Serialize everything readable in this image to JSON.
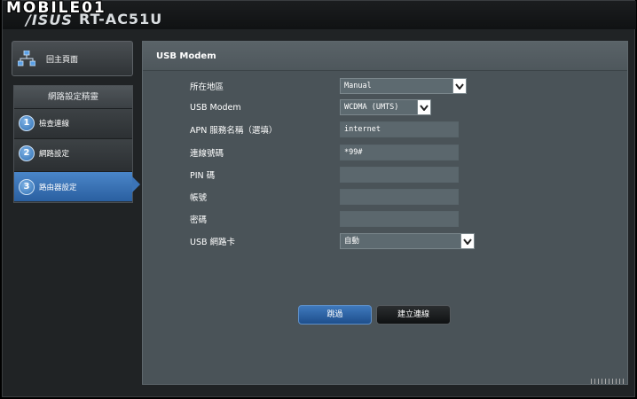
{
  "header": {
    "watermark": "MOBILE01",
    "brand": "/ISUS",
    "model": "RT-AC51U"
  },
  "sidebar": {
    "home_label": "回主頁面",
    "wizard_title": "網路設定精靈",
    "steps": [
      {
        "number": "1",
        "label": "檢查連線"
      },
      {
        "number": "2",
        "label": "網路設定"
      },
      {
        "number": "3",
        "label": "路由器設定"
      }
    ]
  },
  "panel": {
    "title": "USB Modem",
    "fields": [
      {
        "label": "所在地區",
        "value": "Manual"
      },
      {
        "label": "USB Modem",
        "value": "WCDMA (UMTS)"
      },
      {
        "label": "APN 服務名稱（選填）",
        "value": "internet"
      },
      {
        "label": "連線號碼",
        "value": "*99#"
      },
      {
        "label": "PIN 碼",
        "value": ""
      },
      {
        "label": "帳號",
        "value": ""
      },
      {
        "label": "密碼",
        "value": ""
      },
      {
        "label": "USB 網路卡",
        "value": "自動"
      }
    ],
    "buttons": {
      "skip": "跳過",
      "connect": "建立連線"
    }
  },
  "colors": {
    "accent": "#3f79bd",
    "panel_bg": "#4a5358"
  },
  "icons": [
    "home-network-icon",
    "chevron-down-icon"
  ]
}
